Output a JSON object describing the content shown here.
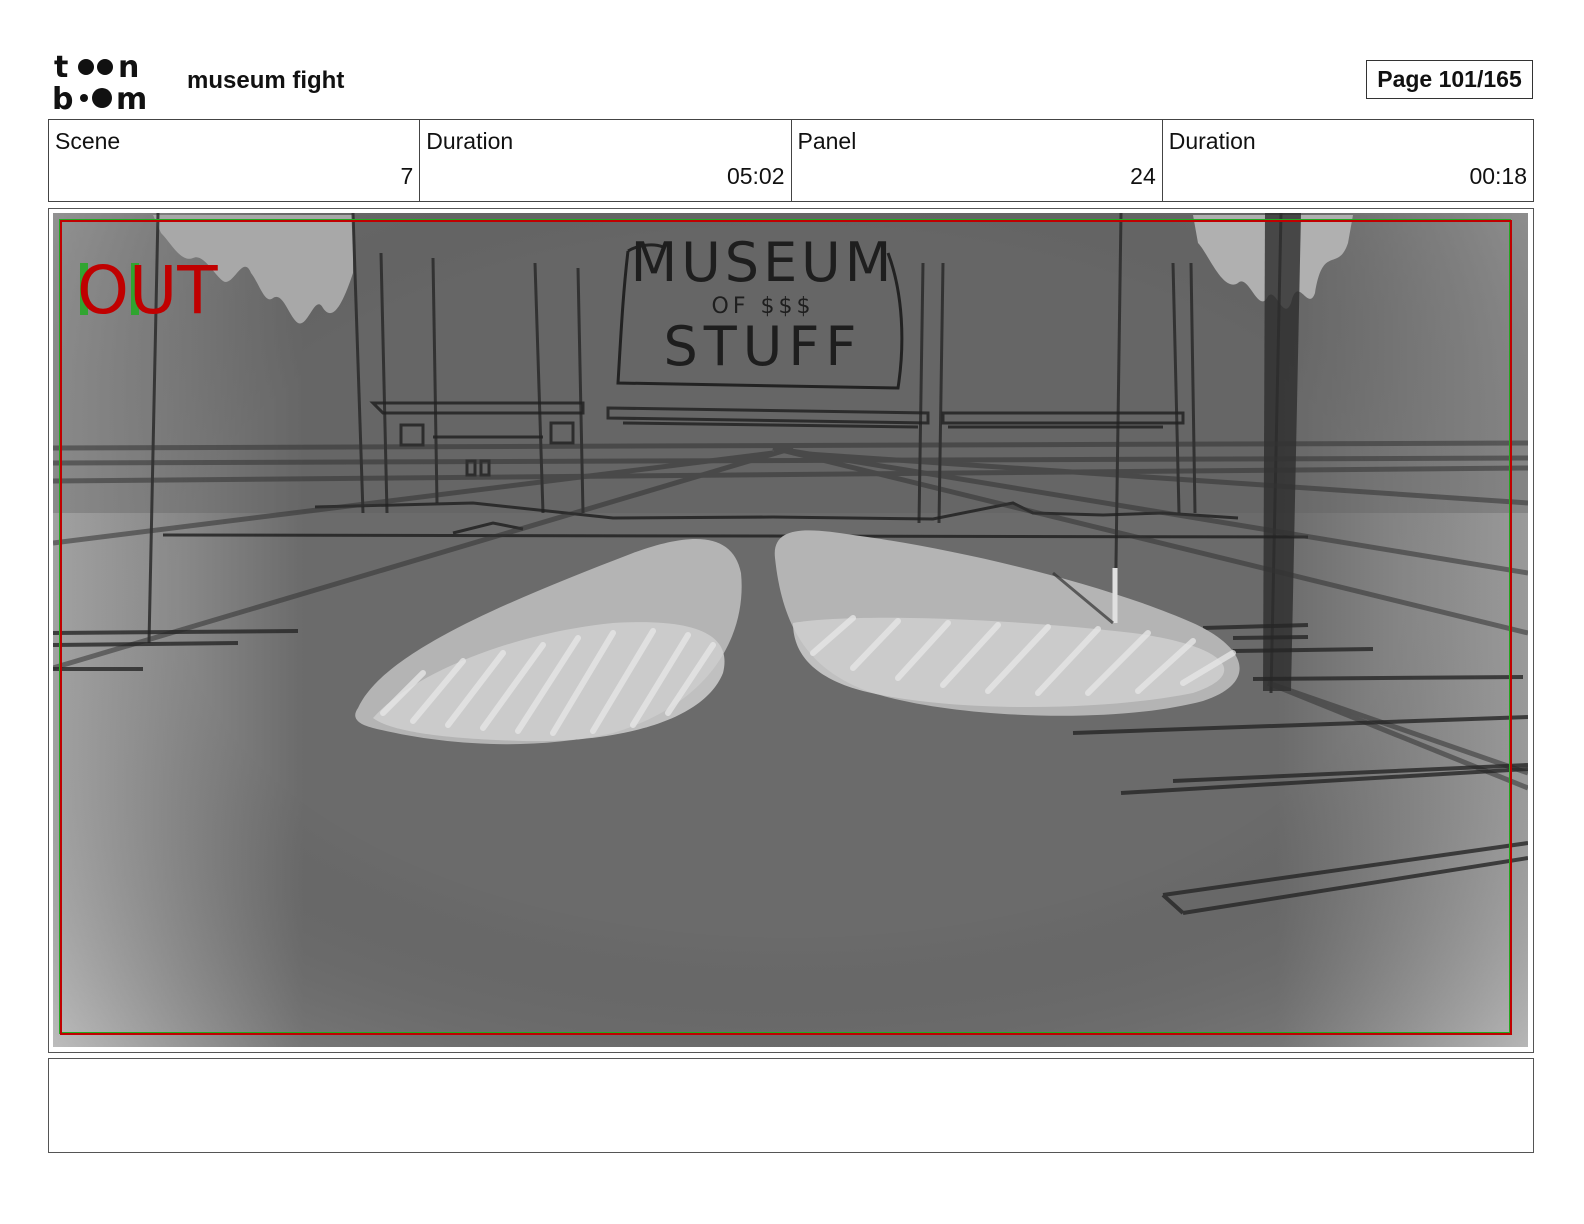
{
  "header": {
    "logo": {
      "brand": "toon boom",
      "icon": "toon-boom-logo"
    },
    "project_title": "museum fight",
    "page_indicator": "Page 101/165"
  },
  "info": [
    {
      "label": "Scene",
      "value": "7"
    },
    {
      "label": "Duration",
      "value": "05:02"
    },
    {
      "label": "Panel",
      "value": "24"
    },
    {
      "label": "Duration",
      "value": "00:18"
    }
  ],
  "panel": {
    "marker": "OUT",
    "marker_color": "#c00000",
    "sign_text": {
      "line1": "MUSEUM",
      "line2": "OF $$$",
      "line3": "STUFF"
    },
    "colors": {
      "background": "#6b6b6b",
      "safe_frame_red": "#c00000",
      "safe_frame_green": "#22aa22"
    }
  },
  "notes": {
    "text": ""
  }
}
